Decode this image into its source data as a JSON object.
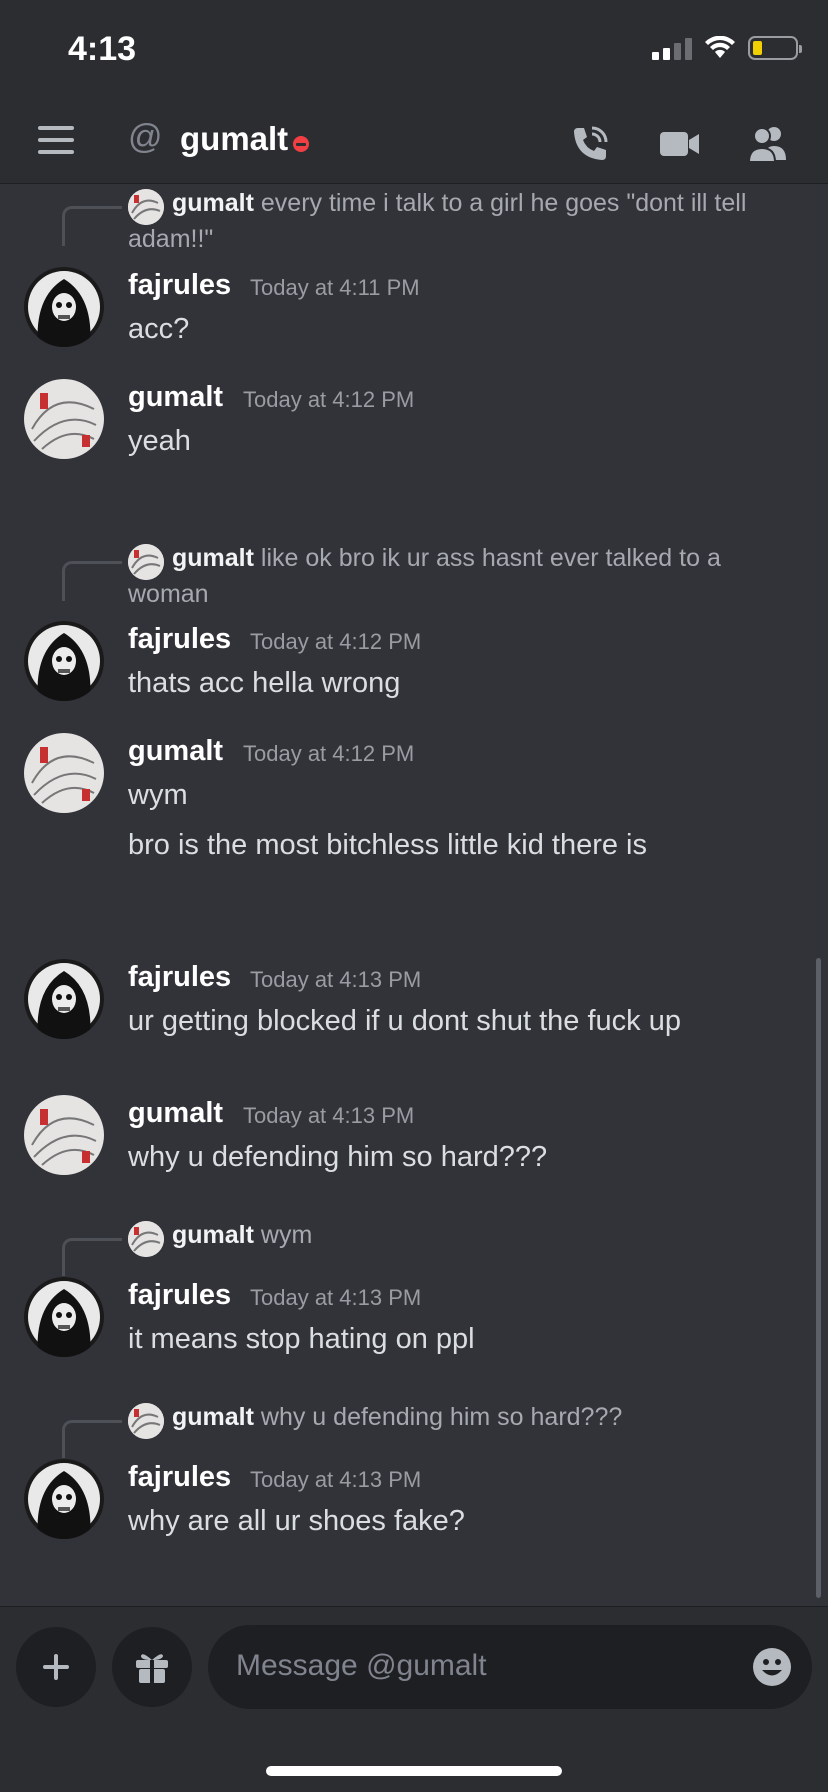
{
  "status_bar": {
    "time": "4:13"
  },
  "header": {
    "at_symbol": "@",
    "channel": "gumalt",
    "status": "do-not-disturb",
    "icons": [
      "menu-icon",
      "call-icon",
      "video-icon",
      "members-icon"
    ]
  },
  "messages": [
    {
      "reply_to": {
        "author": "gumalt",
        "text": "every time i talk to a girl he goes \"dont ill tell adam!!\""
      },
      "author": "fajrules",
      "timestamp": "Today at 4:11 PM",
      "lines": [
        "acc?"
      ]
    },
    {
      "author": "gumalt",
      "timestamp": "Today at 4:12 PM",
      "lines": [
        "yeah"
      ]
    },
    {
      "reply_to": {
        "author": "gumalt",
        "text": "like ok bro ik ur ass hasnt ever talked to a woman"
      },
      "author": "fajrules",
      "timestamp": "Today at 4:12 PM",
      "lines": [
        "thats acc hella wrong"
      ]
    },
    {
      "author": "gumalt",
      "timestamp": "Today at 4:12 PM",
      "lines": [
        "wym",
        "bro is the most bitchless little kid there is"
      ]
    },
    {
      "author": "fajrules",
      "timestamp": "Today at 4:13 PM",
      "lines": [
        "ur getting blocked if u dont shut the fuck up"
      ]
    },
    {
      "author": "gumalt",
      "timestamp": "Today at 4:13 PM",
      "lines": [
        "why u defending him so hard???"
      ]
    },
    {
      "reply_to": {
        "author": "gumalt",
        "text": "wym"
      },
      "author": "fajrules",
      "timestamp": "Today at 4:13 PM",
      "lines": [
        "it means stop hating on ppl"
      ]
    },
    {
      "reply_to": {
        "author": "gumalt",
        "text": "why u defending him so hard???"
      },
      "author": "fajrules",
      "timestamp": "Today at 4:13 PM",
      "lines": [
        "why are all ur shoes fake?"
      ]
    }
  ],
  "composer": {
    "placeholder": "Message @gumalt"
  },
  "colors": {
    "background": "#313338",
    "header": "#2b2d31",
    "input": "#1e1f22",
    "dnd": "#f23f43"
  }
}
